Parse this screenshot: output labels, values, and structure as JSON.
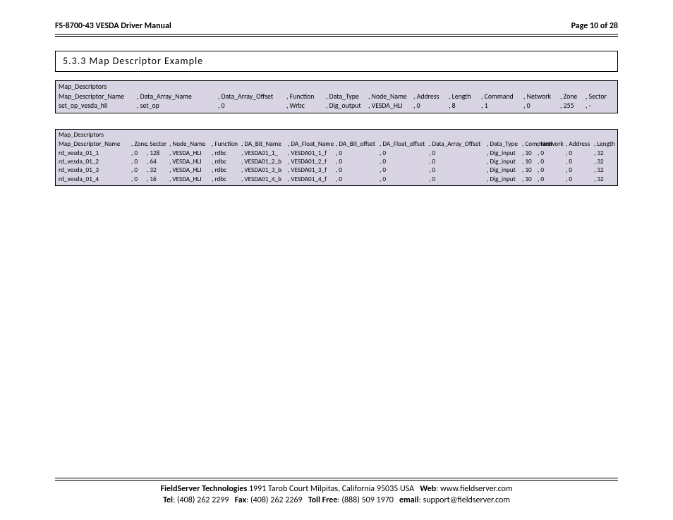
{
  "header": {
    "title": "FS-8700-43 VESDA Driver Manual",
    "page": "Page 10 of 28"
  },
  "section_title": "5.3.3   Map Descriptor Example",
  "table1": {
    "title": "Map_Descriptors",
    "headers": [
      "Map_Descriptor_Name",
      ", Data_Array_Name",
      ", Data_Array_Offset",
      ", Function",
      ", Data_Type",
      ", Node_Name",
      ", Address",
      ", Length",
      ", Command",
      ", Network",
      ", Zone",
      ", Sector"
    ],
    "rows": [
      [
        "set_op_vesda_hli",
        ", set_op",
        ", 0",
        ", Wrbc",
        ", Dig_output",
        ", VESDA_HLI",
        ", 0",
        ", 8",
        ", 1",
        ", 0",
        ", 255",
        ", -"
      ]
    ]
  },
  "table2": {
    "title": "Map_Descriptors",
    "headers": [
      "Map_Descriptor_Name",
      ", Zone",
      ", Sector",
      ", Node_Name",
      ", Function",
      ", DA_Bit_Name",
      ", DA_Float_Name",
      ", DA_Bit_offset",
      ", DA_Float_offset",
      ", Data_Array_Offset",
      ", Data_Type",
      ", Command",
      ", Network",
      ", Address",
      ", Length"
    ],
    "rows": [
      [
        "rd_vesda_01_1",
        ", 0",
        ", 128",
        ", VESDA_HLI",
        ", rdbc",
        ", VESDA01_1_",
        ", VESDA01_1_f",
        ", 0",
        ", 0",
        ", 0",
        ", Dig_input",
        ", 10",
        ", 0",
        ", 0",
        ", 32"
      ],
      [
        "rd_vesda_01_2",
        ", 0",
        ", 64",
        ", VESDA_HLI",
        ", rdbc",
        ", VESDA01_2_b",
        ", VESDA01_2_f",
        ", 0",
        ", 0",
        ", 0",
        ", Dig_input",
        ", 10",
        ", 0",
        ", 0",
        ", 32"
      ],
      [
        "rd_vesda_01_3",
        ", 0",
        ", 32",
        ", VESDA_HLI",
        ", rdbc",
        ", VESDA01_3_b",
        ", VESDA01_3_f",
        ", 0",
        ", 0",
        ", 0",
        ", Dig_input",
        ", 10",
        ", 0",
        ", 0",
        ", 32"
      ],
      [
        "rd_vesda_01_4",
        ", 0",
        ", 16",
        ", VESDA_HLI",
        ", rdbc",
        ", VESDA01_4_b",
        ", VESDA01_4_f",
        ", 0",
        ", 0",
        ", 0",
        ", Dig_input",
        ", 10",
        ", 0",
        ", 0",
        ", 32"
      ]
    ]
  },
  "footer": {
    "company": "FieldServer Technologies",
    "address": "1991 Tarob Court Milpitas, California 95035 USA",
    "web_label": "Web",
    "web": "www.fieldserver.com",
    "tel_label": "Tel",
    "tel": "(408) 262 2299",
    "fax_label": "Fax",
    "fax": "(408) 262 2269",
    "toll_label": "Toll Free",
    "toll": "(888) 509 1970",
    "email_label": "email",
    "email": "support@fieldserver.com"
  }
}
